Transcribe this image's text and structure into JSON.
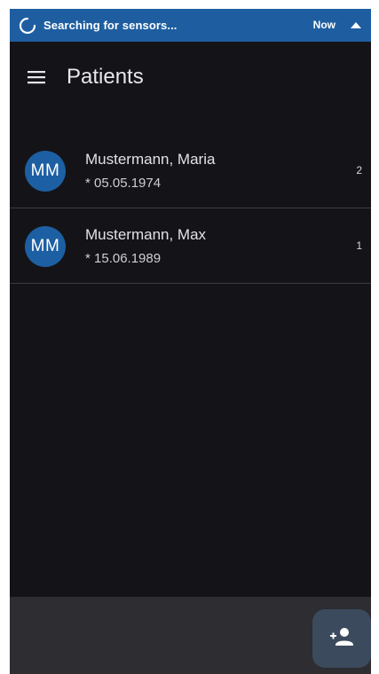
{
  "notification": {
    "title": "Searching for sensors...",
    "time": "Now",
    "icons": [
      "loading-spinner-icon",
      "caret-up-icon"
    ]
  },
  "appbar": {
    "title": "Patients",
    "menu_icon": "hamburger-menu-icon"
  },
  "patients": [
    {
      "initials": "MM",
      "name": "Mustermann, Maria",
      "dob": "* 05.05.1974",
      "count": "2"
    },
    {
      "initials": "MM",
      "name": "Mustermann, Max",
      "dob": "* 15.06.1989",
      "count": "1"
    }
  ],
  "fab": {
    "icon": "add-person-icon"
  },
  "colors": {
    "notification_bg": "#1e5ea0",
    "background": "#141418",
    "avatar": "#1d5fa3",
    "bottom_bar": "#2d2d32",
    "fab": "#3b4a5c"
  }
}
